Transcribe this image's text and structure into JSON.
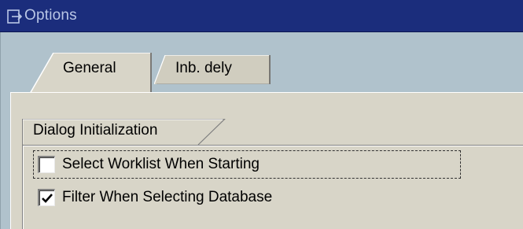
{
  "window": {
    "title": "Options",
    "icon": "window-exit-icon"
  },
  "tabs": [
    {
      "label": "General",
      "active": true
    },
    {
      "label": "Inb. dely",
      "active": false
    }
  ],
  "group": {
    "title": "Dialog Initialization",
    "options": [
      {
        "label": "Select Worklist When Starting",
        "checked": false,
        "focused": true
      },
      {
        "label": "Filter When Selecting Database",
        "checked": true,
        "focused": false
      }
    ]
  },
  "colors": {
    "titlebar": "#1b2d7c",
    "title_text": "#b9c6e6",
    "window_background": "#b0c2cc",
    "panel_background": "#d8d5c8"
  }
}
